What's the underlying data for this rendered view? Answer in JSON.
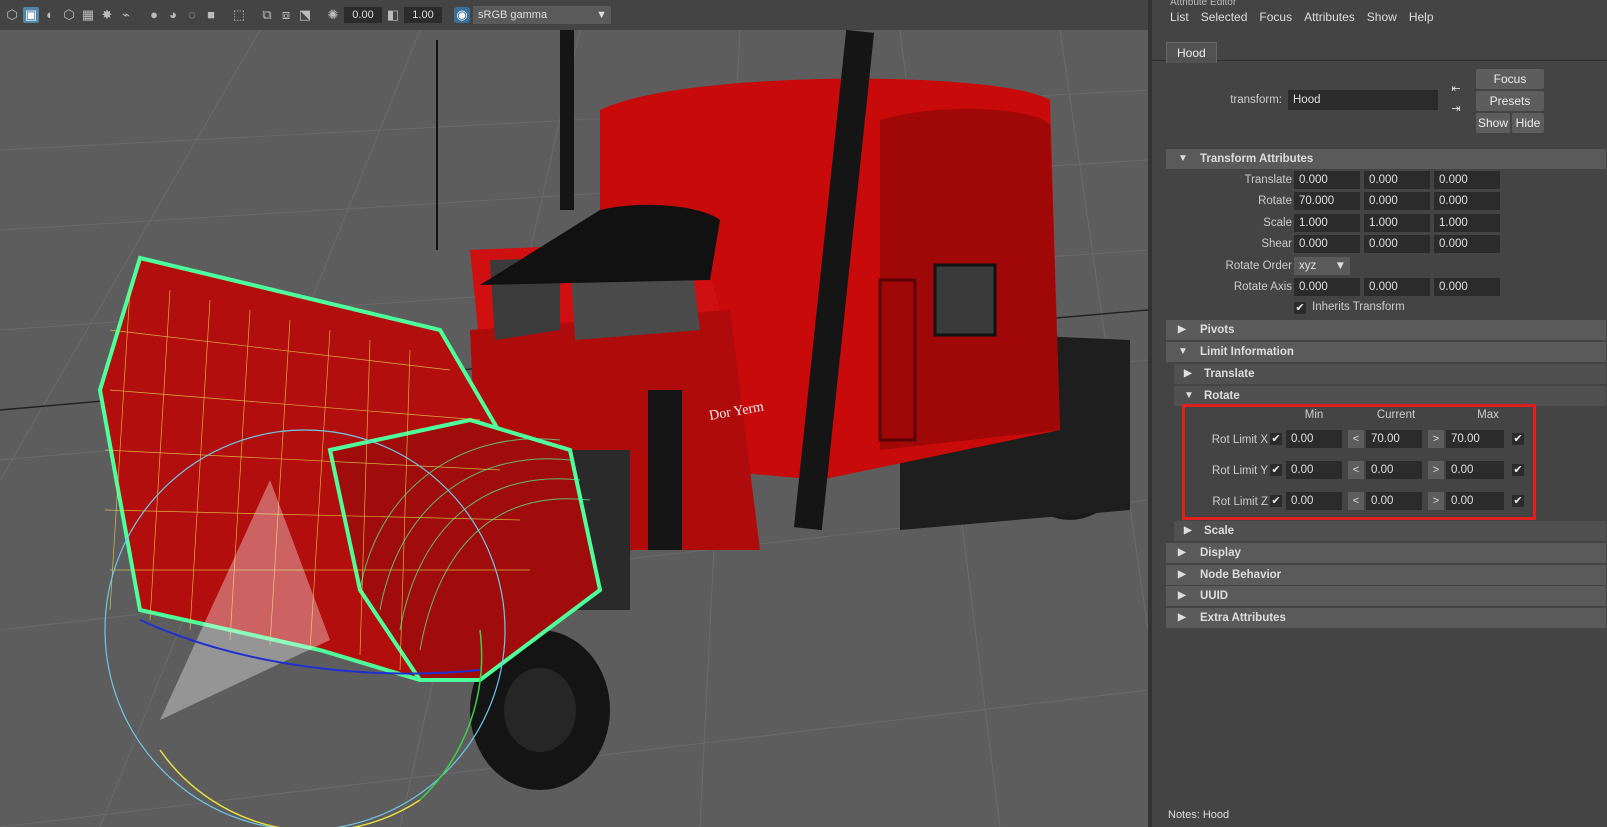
{
  "viewport": {
    "toolbar": {
      "exposure_value": "0.00",
      "gamma_value": "1.00",
      "color_space": "sRGB gamma"
    },
    "truck_door_text": "Dor Yerm"
  },
  "editor": {
    "title": "Attribute Editor",
    "menu": [
      "List",
      "Selected",
      "Focus",
      "Attributes",
      "Show",
      "Help"
    ],
    "tab_label": "Hood",
    "transform_label": "transform:",
    "transform_value": "Hood",
    "buttons": {
      "focus": "Focus",
      "presets": "Presets",
      "show": "Show",
      "hide": "Hide"
    },
    "sections": {
      "transform_attributes": "Transform Attributes",
      "pivots": "Pivots",
      "limit_information": "Limit Information",
      "translate": "Translate",
      "rotate": "Rotate",
      "scale": "Scale",
      "display": "Display",
      "node_behavior": "Node Behavior",
      "uuid": "UUID",
      "extra_attributes": "Extra Attributes"
    },
    "transform": {
      "translate": {
        "label": "Translate",
        "x": "0.000",
        "y": "0.000",
        "z": "0.000"
      },
      "rotate": {
        "label": "Rotate",
        "x": "70.000",
        "y": "0.000",
        "z": "0.000"
      },
      "scale": {
        "label": "Scale",
        "x": "1.000",
        "y": "1.000",
        "z": "1.000"
      },
      "shear": {
        "label": "Shear",
        "x": "0.000",
        "y": "0.000",
        "z": "0.000"
      },
      "rotate_order": {
        "label": "Rotate Order",
        "value": "xyz"
      },
      "rotate_axis": {
        "label": "Rotate Axis",
        "x": "0.000",
        "y": "0.000",
        "z": "0.000"
      },
      "inherits_transform": {
        "label": "Inherits Transform",
        "checked": true
      }
    },
    "rotate_limits": {
      "headers": {
        "min": "Min",
        "current": "Current",
        "max": "Max"
      },
      "less_than": "<",
      "greater_than": ">",
      "x": {
        "label": "Rot Limit X",
        "min": "0.00",
        "current": "70.00",
        "max": "70.00",
        "min_on": true,
        "max_on": true
      },
      "y": {
        "label": "Rot Limit Y",
        "min": "0.00",
        "current": "0.00",
        "max": "0.00",
        "min_on": true,
        "max_on": true
      },
      "z": {
        "label": "Rot Limit Z",
        "min": "0.00",
        "current": "0.00",
        "max": "0.00",
        "min_on": true,
        "max_on": true
      }
    },
    "notes_label": "Notes:",
    "notes_value": "Hood"
  },
  "colors": {
    "viewport_bg": "#5d5d5d",
    "panel_bg": "#444444",
    "field_bg": "#2b2b2b",
    "truck_red": "#c80a0a",
    "wireframe": "#4dff9a",
    "highlight_box": "#e02020"
  }
}
